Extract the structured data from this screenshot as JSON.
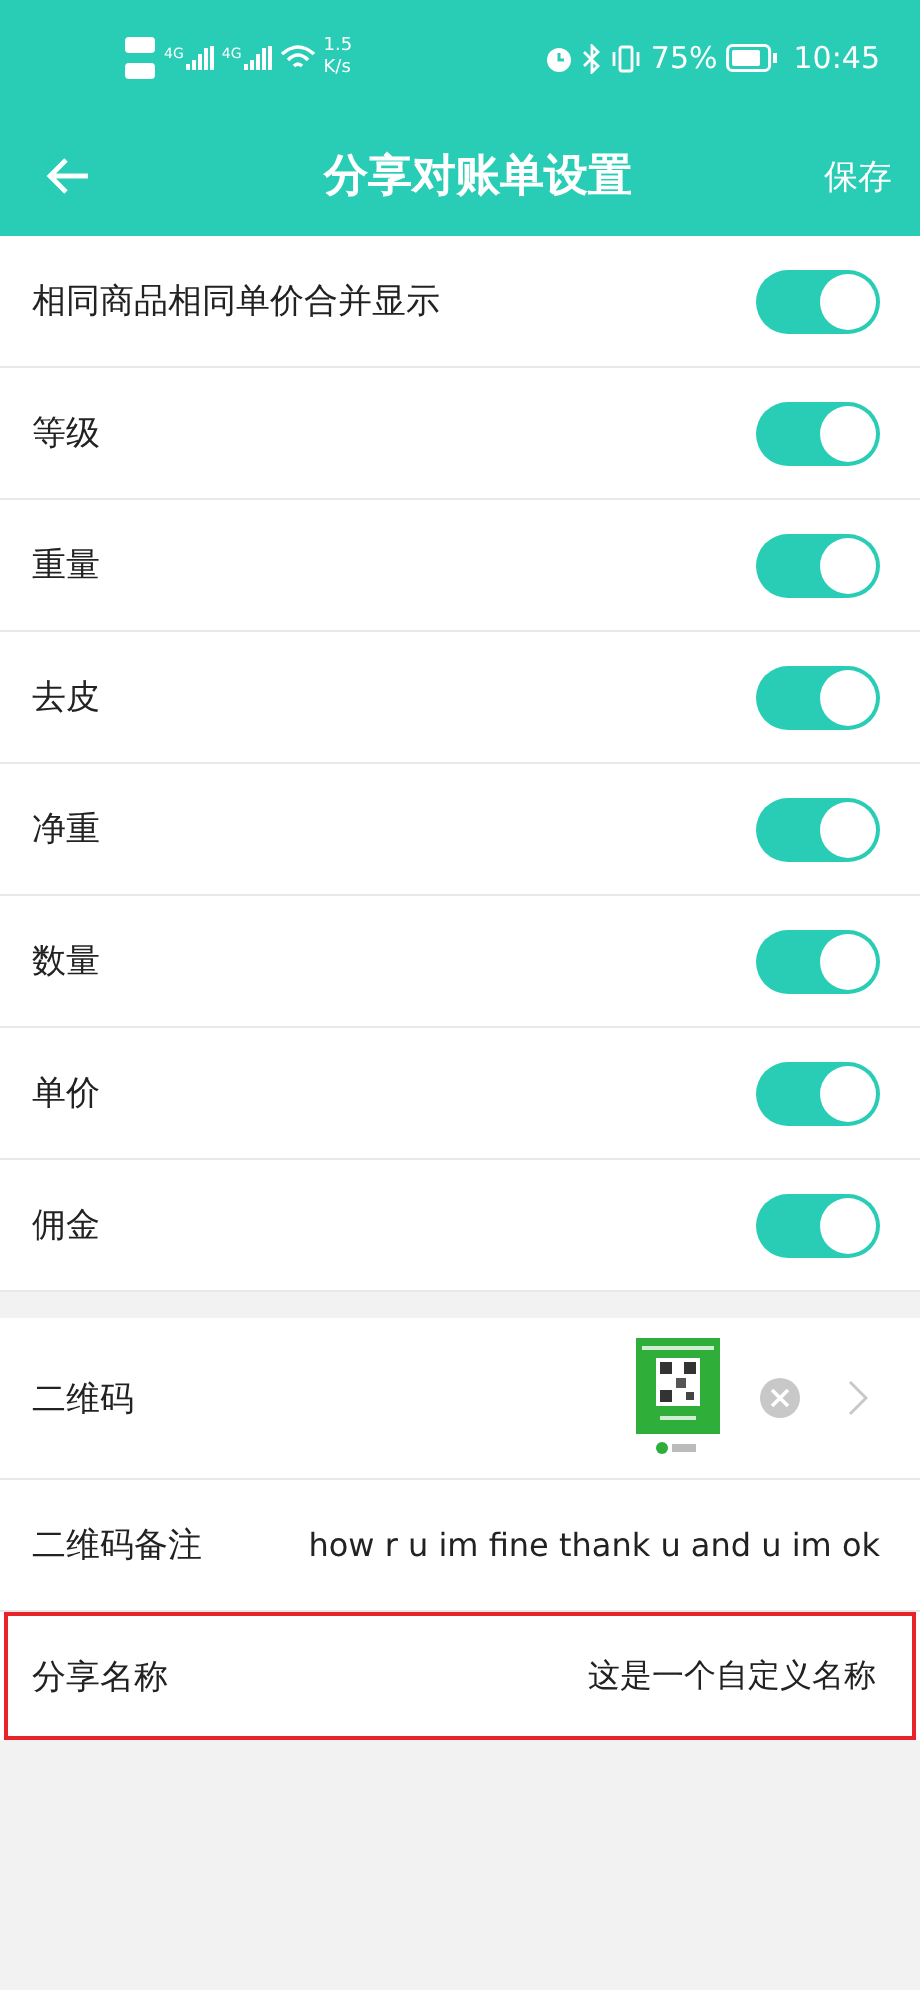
{
  "status_bar": {
    "network": [
      "4G",
      "4G"
    ],
    "speed": [
      "1.5",
      "K/s"
    ],
    "battery": "75%",
    "time": "10:45"
  },
  "header": {
    "title": "分享对账单设置",
    "action": "保存"
  },
  "toggles": [
    {
      "label": "相同商品相同单价合并显示",
      "on": true
    },
    {
      "label": "等级",
      "on": true
    },
    {
      "label": "重量",
      "on": true
    },
    {
      "label": "去皮",
      "on": true
    },
    {
      "label": "净重",
      "on": true
    },
    {
      "label": "数量",
      "on": true
    },
    {
      "label": "单价",
      "on": true
    },
    {
      "label": "佣金",
      "on": true
    }
  ],
  "details": [
    {
      "label": "二维码",
      "highlighted": false
    },
    {
      "kind": "text",
      "label": "二维码备注",
      "value": "how r u im fine thank u and u im ok",
      "highlighted": false
    },
    {
      "kind": "text",
      "label": "分享名称",
      "value": "这是一个自定义名称",
      "highlighted": true
    }
  ]
}
